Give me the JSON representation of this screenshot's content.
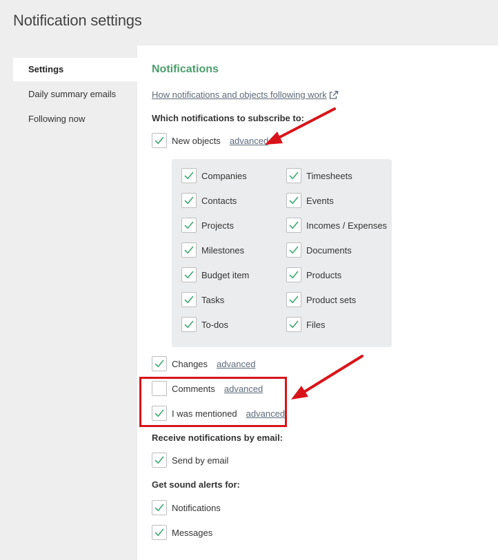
{
  "page": {
    "title": "Notification settings"
  },
  "sidebar": {
    "items": [
      {
        "label": "Settings",
        "active": true
      },
      {
        "label": "Daily summary emails",
        "active": false
      },
      {
        "label": "Following now",
        "active": false
      }
    ]
  },
  "main": {
    "section_title": "Notifications",
    "help_link": "How notifications and objects following work",
    "subscribe_label": "Which notifications to subscribe to:",
    "new_objects": {
      "label": "New objects",
      "advanced": "advanced",
      "checked": true
    },
    "object_types_left": [
      {
        "label": "Companies",
        "checked": true
      },
      {
        "label": "Contacts",
        "checked": true
      },
      {
        "label": "Projects",
        "checked": true
      },
      {
        "label": "Milestones",
        "checked": true
      },
      {
        "label": "Budget item",
        "checked": true
      },
      {
        "label": "Tasks",
        "checked": true
      },
      {
        "label": "To-dos",
        "checked": true
      }
    ],
    "object_types_right": [
      {
        "label": "Timesheets",
        "checked": true
      },
      {
        "label": "Events",
        "checked": true
      },
      {
        "label": "Incomes / Expenses",
        "checked": true
      },
      {
        "label": "Documents",
        "checked": true
      },
      {
        "label": "Products",
        "checked": true
      },
      {
        "label": "Product sets",
        "checked": true
      },
      {
        "label": "Files",
        "checked": true
      }
    ],
    "changes": {
      "label": "Changes",
      "advanced": "advanced",
      "checked": true
    },
    "comments": {
      "label": "Comments",
      "advanced": "advanced",
      "checked": false
    },
    "mentioned": {
      "label": "I was mentioned",
      "advanced": "advanced",
      "checked": true
    },
    "email_label": "Receive notifications by email:",
    "send_by_email": {
      "label": "Send by email",
      "checked": true
    },
    "sound_label": "Get sound alerts for:",
    "sound_notifications": {
      "label": "Notifications",
      "checked": true
    },
    "sound_messages": {
      "label": "Messages",
      "checked": true
    }
  },
  "colors": {
    "accent_green": "#4a9e6b",
    "check_green": "#3fa872",
    "annotation_red": "#d8141a",
    "link": "#5d6a7a"
  },
  "icons": {
    "check": "check-icon",
    "external": "external-link-icon"
  }
}
